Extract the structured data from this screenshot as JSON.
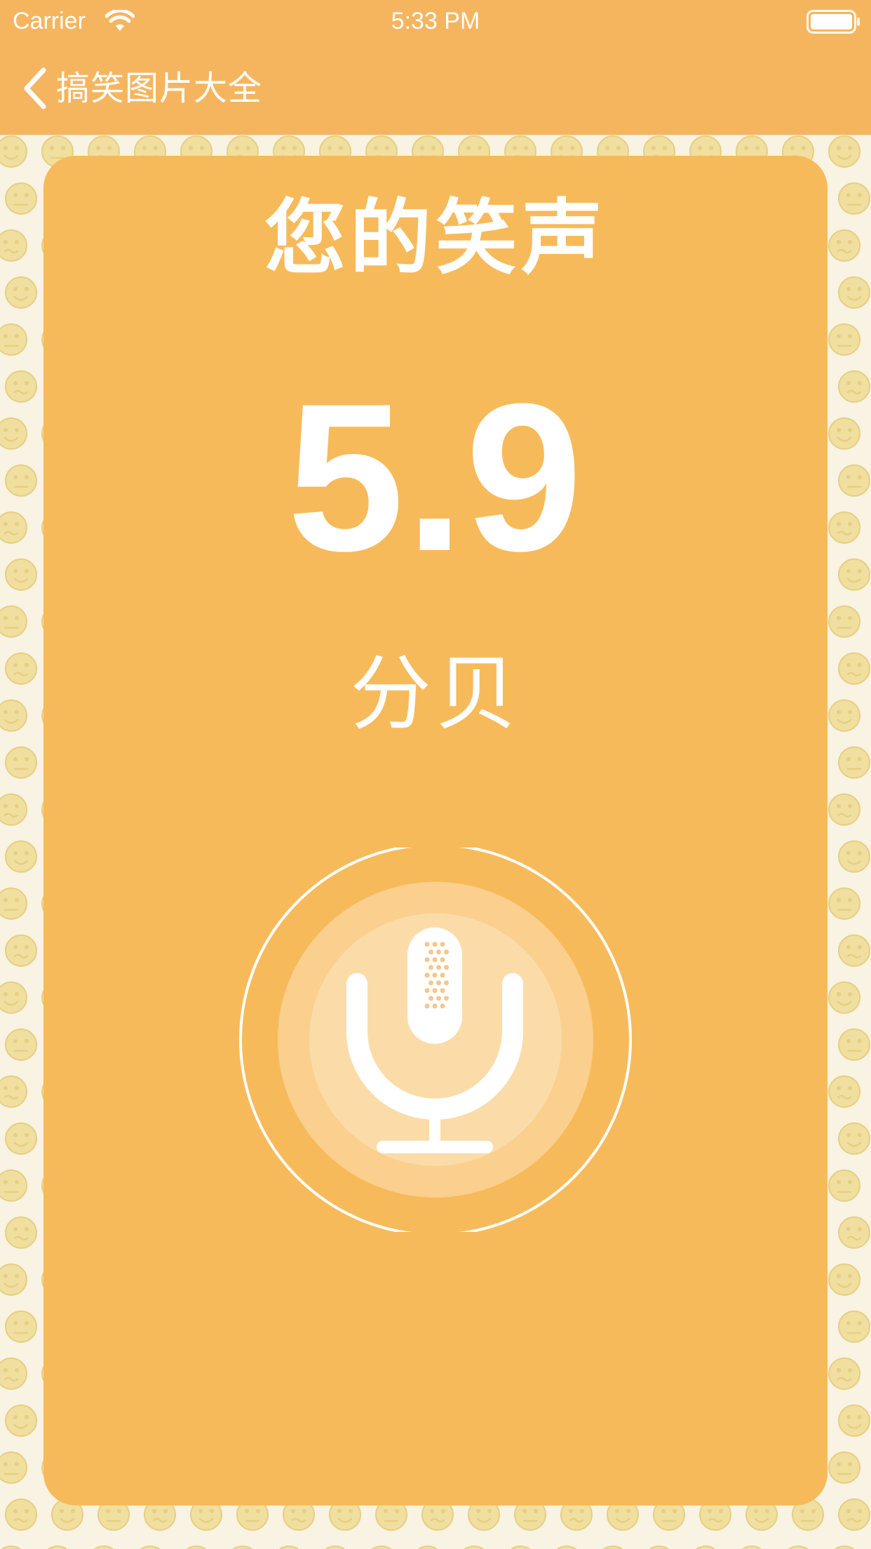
{
  "status_bar": {
    "carrier": "Carrier",
    "time": "5:33 PM",
    "wifi_icon": "wifi-icon",
    "battery_icon": "battery-full-icon"
  },
  "nav": {
    "back_label": "搞笑图片大全",
    "back_icon": "chevron-left-icon"
  },
  "card": {
    "title": "您的笑声",
    "score": "5.9",
    "unit": "分贝"
  },
  "mic": {
    "icon": "microphone-icon"
  },
  "colors": {
    "accent": "#f5b55f",
    "card": "#f7ba5a",
    "background": "#f8f3e2",
    "emoji": "#f1df9f",
    "text": "#ffffff"
  }
}
